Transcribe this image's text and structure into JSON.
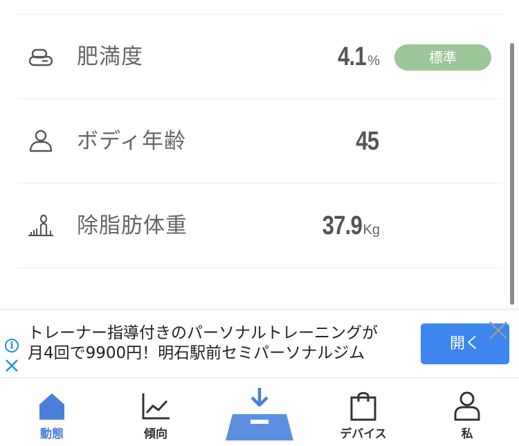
{
  "metrics": [
    {
      "label": "肥満度",
      "value": "4.1",
      "unit": "%",
      "status": "標準",
      "icon": "body-fat-icon"
    },
    {
      "label": "ボディ年齢",
      "value": "45",
      "unit": "",
      "icon": "person-icon"
    },
    {
      "label": "除脂肪体重",
      "value": "37.9",
      "unit": "Kg",
      "icon": "lean-mass-icon"
    }
  ],
  "ad": {
    "text_line1": "トレーナー指導付きのパーソナルトレーニングが",
    "text_line2": "月4回で9900円！明石駅前セミパーソナルジム",
    "button": "開く",
    "info_glyph": "i"
  },
  "nav": {
    "items": [
      {
        "label": "動態",
        "icon": "home-icon",
        "active": true
      },
      {
        "label": "傾向",
        "icon": "trend-chart-icon"
      },
      {
        "label": "",
        "icon": "scale-icon"
      },
      {
        "label": "デバイス",
        "icon": "shopping-bag-icon"
      },
      {
        "label": "私",
        "icon": "profile-icon"
      }
    ]
  },
  "colors": {
    "badge": "#9cc59a",
    "ad_button": "#3d86f0",
    "nav_active": "#4a7fd8",
    "scale_blue": "#5b8fe0"
  }
}
